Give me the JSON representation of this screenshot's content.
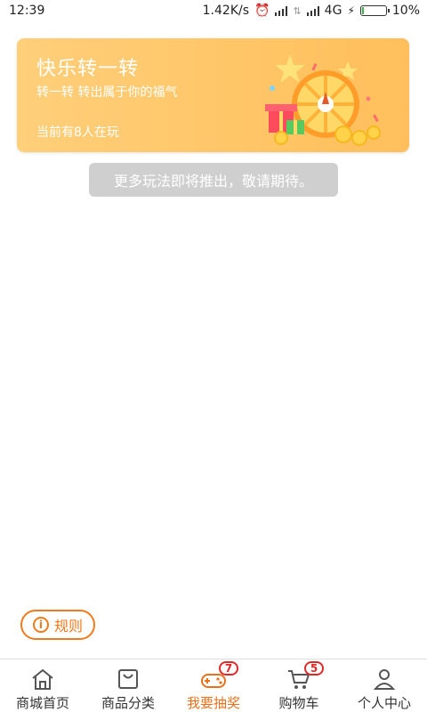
{
  "status_bar": {
    "time": "12:39",
    "speed": "1.42K/s",
    "network": "4G",
    "battery": "10%",
    "battery_level": 0.1
  },
  "banner": {
    "title": "快乐转一转",
    "subtitle": "转一转  转出属于你的福气",
    "players": "当前有8人在玩"
  },
  "toast": {
    "text": "更多玩法即将推出，敬请期待。"
  },
  "rules_button": {
    "label": "规则",
    "icon": "info-icon"
  },
  "bottom_nav": {
    "items": [
      {
        "label": "商城首页",
        "icon": "home-icon",
        "active": false,
        "badge": ""
      },
      {
        "label": "商品分类",
        "icon": "bag-icon",
        "active": false,
        "badge": ""
      },
      {
        "label": "我要抽奖",
        "icon": "gamepad-icon",
        "active": true,
        "badge": "7"
      },
      {
        "label": "购物车",
        "icon": "cart-icon",
        "active": false,
        "badge": "5"
      },
      {
        "label": "个人中心",
        "icon": "user-icon",
        "active": false,
        "badge": ""
      }
    ]
  },
  "colors": {
    "accent": "#e9711c",
    "banner": "#ffc566",
    "badge": "#e02a2a",
    "toast": "#cfcfcf"
  }
}
